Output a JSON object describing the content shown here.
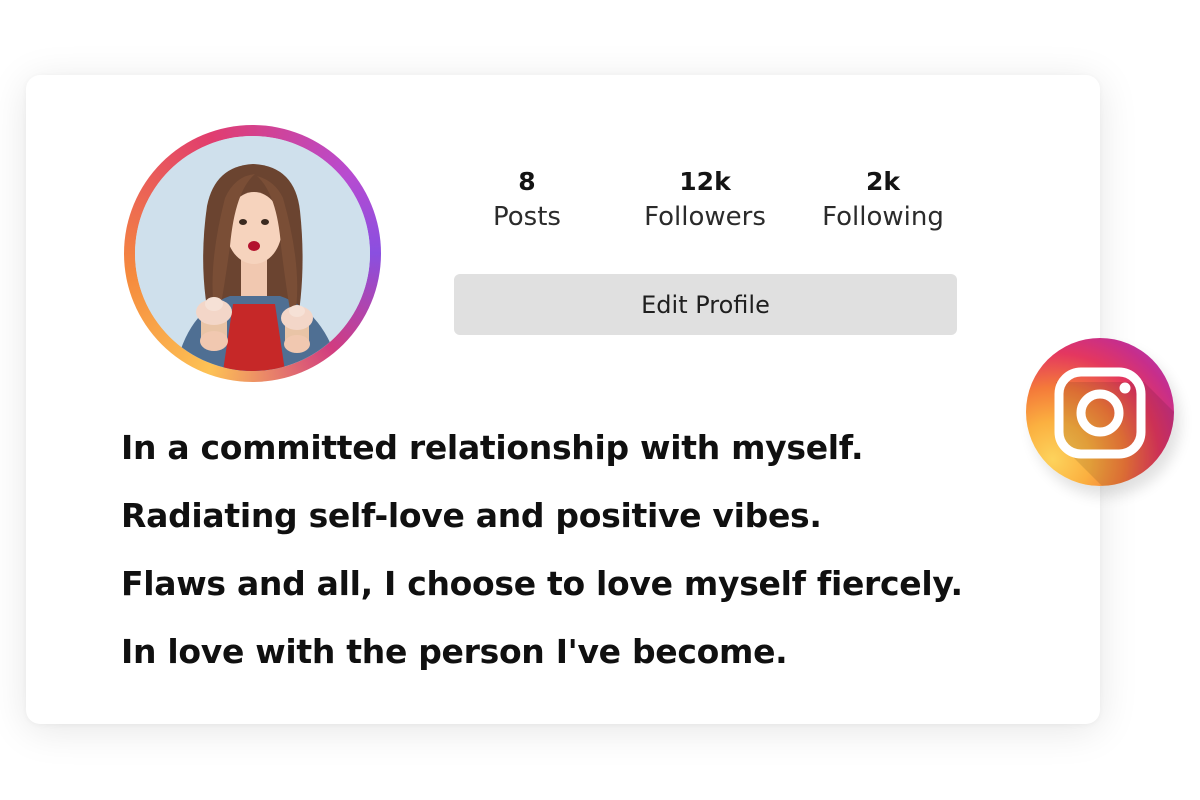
{
  "profile": {
    "avatar_alt": "profile-photo",
    "stats": [
      {
        "value": "8",
        "label": "Posts"
      },
      {
        "value": "12k",
        "label": "Followers"
      },
      {
        "value": "2k",
        "label": "Following"
      }
    ],
    "edit_button_label": "Edit Profile",
    "bio_lines": [
      "In a committed relationship with myself.",
      "Radiating self-love and positive vibes.",
      "Flaws and all, I choose to love myself fiercely.",
      "In love with the person I've become."
    ]
  },
  "badge": {
    "icon": "instagram-logo-icon"
  },
  "colors": {
    "button_bg": "#e0e0e0",
    "text": "#101010",
    "ring_start": "#fdc255",
    "ring_mid": "#e13d6e",
    "ring_end": "#8a4fe0"
  }
}
